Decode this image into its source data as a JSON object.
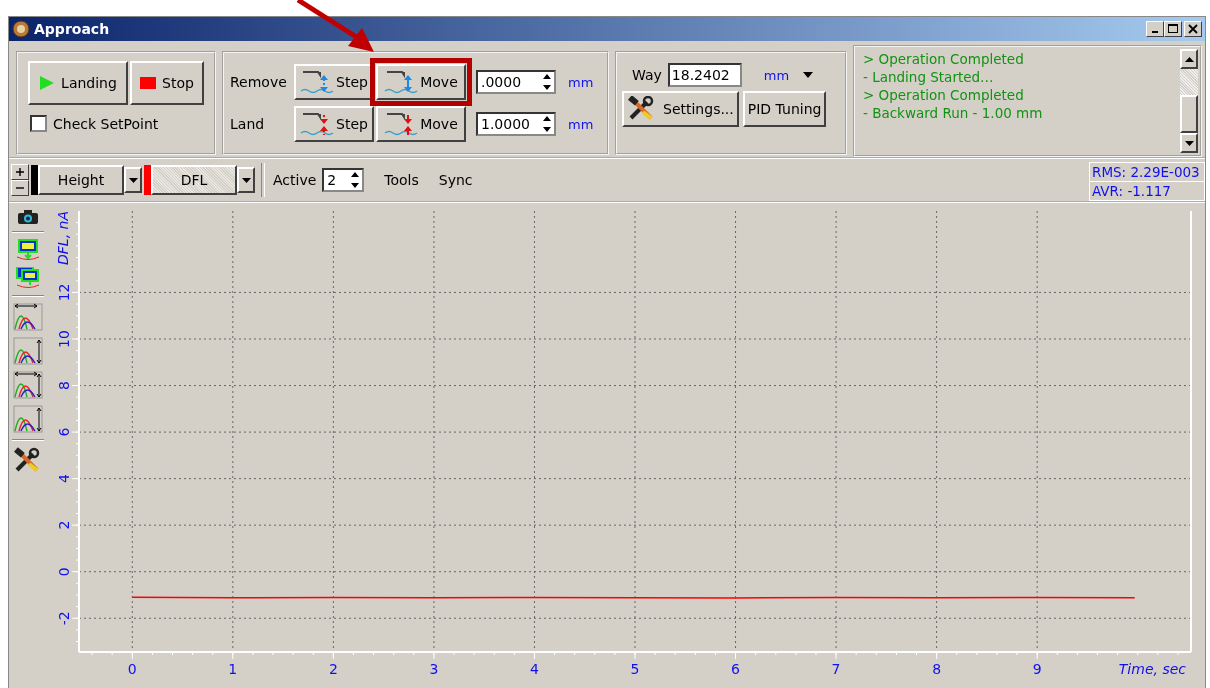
{
  "window": {
    "title": "Approach"
  },
  "run": {
    "buttons": [
      {
        "label": "Landing",
        "kind": "play"
      },
      {
        "label": "Stop",
        "kind": "stop"
      }
    ],
    "check": {
      "label": "Check SetPoint",
      "checked": false
    }
  },
  "motion": {
    "rows": [
      {
        "label": "Remove",
        "kind": "remove",
        "buttons": [
          {
            "label": "Step",
            "kind": "step",
            "highlighted": false
          },
          {
            "label": "Move",
            "kind": "move",
            "highlighted": true
          }
        ],
        "value": ".0000",
        "unit": "mm"
      },
      {
        "label": "Land",
        "kind": "land",
        "buttons": [
          {
            "label": "Step",
            "kind": "step",
            "highlighted": false
          },
          {
            "label": "Move",
            "kind": "move",
            "highlighted": false
          }
        ],
        "value": "1.0000",
        "unit": "mm"
      }
    ]
  },
  "way": {
    "label": "Way",
    "value": "18.2402",
    "unit": "mm",
    "buttons": [
      {
        "label": "Settings...",
        "kind": "tools"
      },
      {
        "label": "PID Tuning",
        "kind": "text"
      }
    ]
  },
  "log": [
    "> Operation Completed",
    "- Landing Started…",
    "> Operation Completed",
    "- Backward Run - 1.00 mm"
  ],
  "toolbar": {
    "channels": [
      {
        "label": "Height",
        "color": "#000000"
      },
      {
        "label": "DFL",
        "color": "#ff0000"
      }
    ],
    "active_label": "Active",
    "active_value": "2",
    "items": [
      "Tools",
      "Sync"
    ],
    "stats": [
      "RMS: 2.29E-003",
      "AVR: -1.117"
    ]
  },
  "chart": {
    "chart_data": {
      "type": "line",
      "grid": true,
      "xlabel": "Time, sec",
      "ylabel": "DFL, nA",
      "xlim": [
        -0.53,
        10.53
      ],
      "ylim": [
        -3.45,
        15.5
      ],
      "xticks": [
        0,
        1,
        2,
        3,
        4,
        5,
        6,
        7,
        8,
        9
      ],
      "yticks": [
        -2,
        0,
        2,
        4,
        6,
        8,
        10,
        12
      ],
      "x": [
        0,
        1,
        2,
        3,
        4,
        5,
        6,
        7,
        8,
        9,
        9.97
      ],
      "series": [
        {
          "color": "#ff0000",
          "values": [
            -1.1,
            -1.12,
            -1.11,
            -1.12,
            -1.11,
            -1.12,
            -1.13,
            -1.11,
            -1.12,
            -1.11,
            -1.12
          ]
        }
      ]
    }
  }
}
